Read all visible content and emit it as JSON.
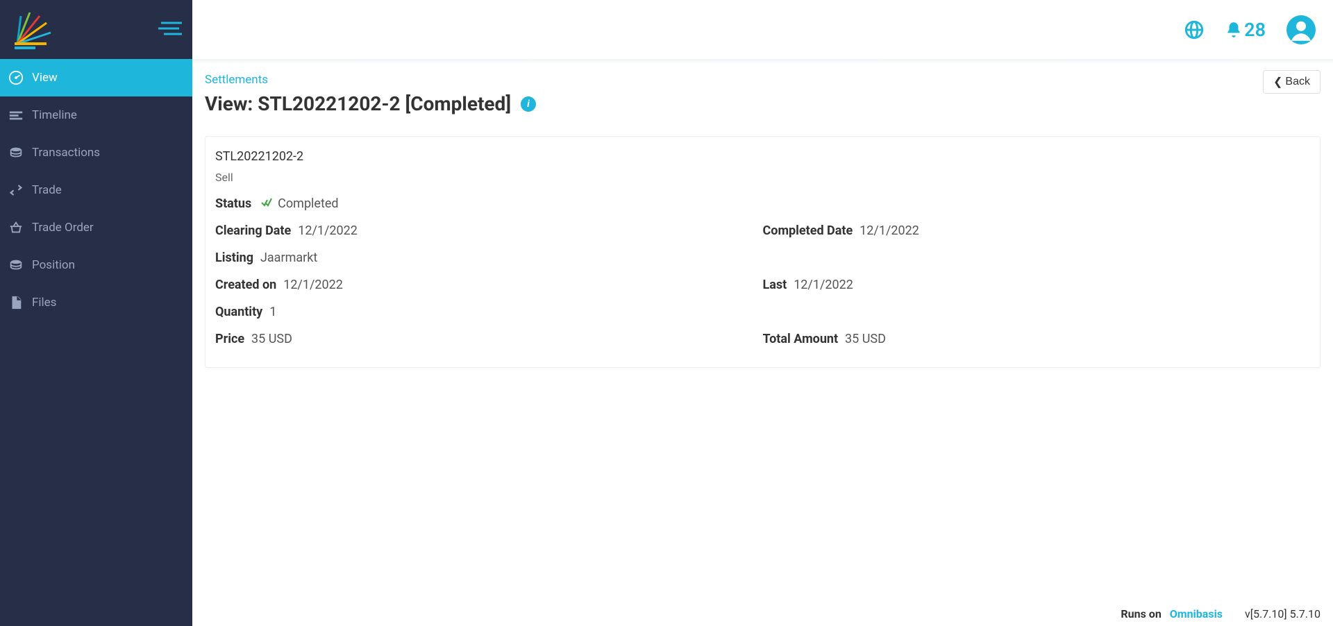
{
  "sidebar": {
    "items": [
      {
        "label": "View"
      },
      {
        "label": "Timeline"
      },
      {
        "label": "Transactions"
      },
      {
        "label": "Trade"
      },
      {
        "label": "Trade Order"
      },
      {
        "label": "Position"
      },
      {
        "label": "Files"
      }
    ]
  },
  "header": {
    "notification_count": "28"
  },
  "breadcrumb": {
    "link": "Settlements"
  },
  "page": {
    "title": "View: STL20221202-2 [Completed]"
  },
  "back": {
    "label": "Back"
  },
  "details": {
    "id": "STL20221202-2",
    "type": "Sell",
    "status_label": "Status",
    "status_value": "Completed",
    "clearing_date_label": "Clearing Date",
    "clearing_date_value": "12/1/2022",
    "completed_date_label": "Completed Date",
    "completed_date_value": "12/1/2022",
    "listing_label": "Listing",
    "listing_value": "Jaarmarkt",
    "created_on_label": "Created on",
    "created_on_value": "12/1/2022",
    "last_label": "Last",
    "last_value": "12/1/2022",
    "quantity_label": "Quantity",
    "quantity_value": "1",
    "price_label": "Price",
    "price_value": "35 USD",
    "total_amount_label": "Total Amount",
    "total_amount_value": "35 USD"
  },
  "footer": {
    "runs_on": "Runs on",
    "brand": "Omnibasis",
    "version": "v[5.7.10] 5.7.10"
  }
}
